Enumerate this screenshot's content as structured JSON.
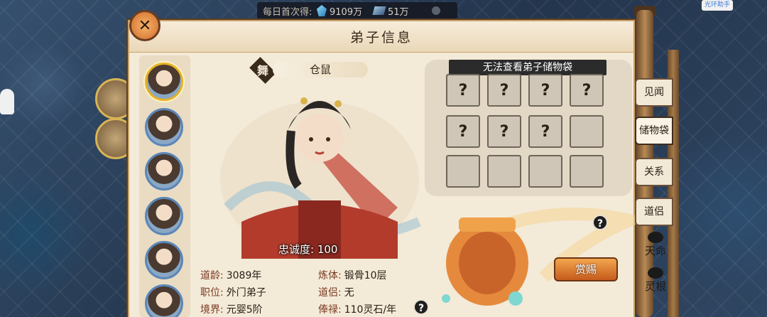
{
  "topbar": {
    "daily_label": "每日首次得:",
    "gem_value": "9109万",
    "stone_value": "51万",
    "helper": "光环助手"
  },
  "panel": {
    "title": "弟子信息",
    "close_icon": "brush-x-icon"
  },
  "character": {
    "type_badge": "舞",
    "name": "仓鼠",
    "loyalty": "忠诚度: 100"
  },
  "stats": {
    "age_label": "道龄:",
    "age_value": "3089年",
    "post_label": "职位:",
    "post_value": "外门弟子",
    "realm_label": "境界:",
    "realm_value": "元婴5阶",
    "body_label": "炼体:",
    "body_value": "锻骨10层",
    "companion_label": "道侣:",
    "companion_value": "无",
    "salary_label": "俸禄:",
    "salary_value": "110灵石/年"
  },
  "bag": {
    "title": "无法查看弟子储物袋",
    "slots": [
      "?",
      "?",
      "?",
      "?",
      "?",
      "?",
      "?",
      "",
      "",
      "",
      "",
      ""
    ]
  },
  "reward": {
    "button": "赏赐"
  },
  "tabs": {
    "seen": "见闻",
    "bag": "储物袋",
    "relation": "关系",
    "partner": "道侣",
    "fate": "天命",
    "root": "灵根"
  },
  "colors": {
    "panel_bg": "#f4ead8",
    "accent_gold": "#e6b224",
    "reward_orange": "#f3a64d"
  }
}
